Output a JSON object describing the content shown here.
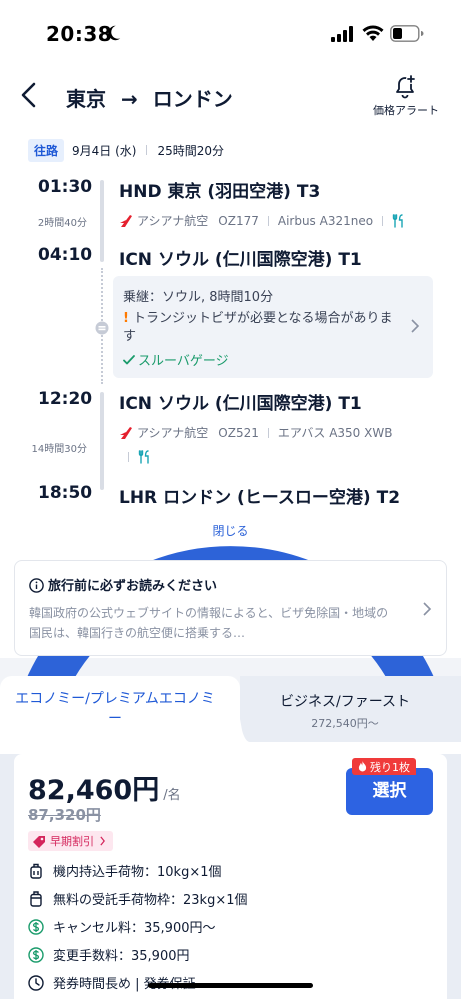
{
  "status_bar": {
    "time": "20:38"
  },
  "header": {
    "origin": "東京",
    "arrow": "→",
    "destination": "ロンドン",
    "price_alert_label": "価格アラート"
  },
  "itinerary": {
    "direction_badge": "往路",
    "date": "9月4日 (水)",
    "total_duration": "25時間20分",
    "segments": [
      {
        "dep_time": "01:30",
        "dep_airport": "HND 東京 (羽田空港) T3",
        "duration": "2時間40分",
        "airline": "アシアナ航空",
        "flight_no": "OZ177",
        "aircraft": "Airbus A321neo",
        "arr_time": "04:10",
        "arr_airport": "ICN ソウル (仁川国際空港) T1"
      },
      {
        "dep_time": "12:20",
        "dep_airport": "ICN ソウル (仁川国際空港) T1",
        "duration": "14時間30分",
        "airline": "アシアナ航空",
        "flight_no": "OZ521",
        "aircraft": "エアバス A350 XWB",
        "arr_time": "18:50",
        "arr_airport": "LHR ロンドン (ヒースロー空港) T2"
      }
    ],
    "transfer": {
      "title": "乗継：ソウル, 8時間10分",
      "warning_mark": "!",
      "warning": "トランジットビザが必要となる場合があります",
      "baggage": "スルーバゲージ"
    },
    "close_label": "閉じる"
  },
  "notice": {
    "title": "旅行前に必ずお読みください",
    "body": "韓国政府の公式ウェブサイトの情報によると、ビザ免除国・地域の国民は、韓国行きの航空便に搭乗する…"
  },
  "tabs": [
    {
      "label": "エコノミー/プレミアムエコノミー",
      "active": true
    },
    {
      "label": "ビジネス/ファースト",
      "sub": "272,540円〜",
      "active": false
    }
  ],
  "fare": {
    "price": "82,460円",
    "unit": "/名",
    "old_price": "87,320円",
    "early_label": "早期割引",
    "remaining_badge": "残り1枚",
    "select_label": "選択",
    "features": [
      {
        "icon": "carry-on-bag-icon",
        "text": "機内持込手荷物：10kg×1個"
      },
      {
        "icon": "checked-bag-icon",
        "text": "無料の受託手荷物枠：23kg×1個"
      },
      {
        "icon": "dollar-circle-icon",
        "text": "キャンセル料：35,900円〜"
      },
      {
        "icon": "dollar-circle-icon",
        "text": "変更手数料：35,900円"
      },
      {
        "icon": "clock-icon",
        "text": "発券時間長め | 発券保証"
      }
    ]
  },
  "colors": {
    "primary": "#2d63e2",
    "airline_red": "#e5202e",
    "warning": "#ff7a00",
    "success": "#1a9b6b",
    "badge_red": "#f03a3a"
  }
}
